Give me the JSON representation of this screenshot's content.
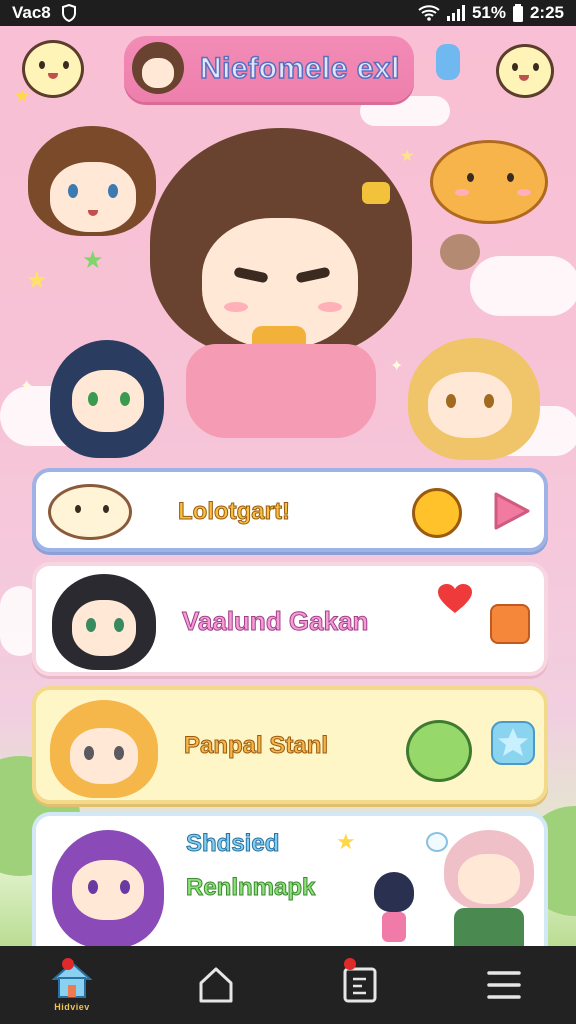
{
  "status_bar": {
    "left_text": "Vac8",
    "battery": "51%",
    "time": "2:25"
  },
  "header": {
    "title": "Niefomele exl"
  },
  "cards": [
    {
      "label": "Lolotgart!",
      "action_icon": "play-arrow-icon",
      "mascot_icon": "sun-mascot-icon"
    },
    {
      "label": "Vaalund Gakan",
      "action_icon": "shopping-bag-icon",
      "mascot_icon": "heart-icon"
    },
    {
      "label": "Panpal Stanl",
      "action_icon": "star-icon",
      "mascot_icon": "bunny-mascot-icon"
    },
    {
      "label_line1": "Shdsied",
      "label_line2": "Renlnmapk",
      "mascot_icon": "chat-bubble-icon"
    }
  ],
  "bottom_nav": {
    "items": [
      {
        "name": "home",
        "label": "Hidviev",
        "icon": "home-icon",
        "badge": true
      },
      {
        "name": "house",
        "label": "",
        "icon": "house-outline-icon",
        "badge": false
      },
      {
        "name": "notes",
        "label": "",
        "icon": "note-icon",
        "badge": true,
        "badge_count": "1"
      },
      {
        "name": "menu",
        "label": "",
        "icon": "menu-icon",
        "badge": false
      }
    ]
  },
  "colors": {
    "background": "#f7c6d8",
    "title_pill": "#ee7fac",
    "card1_border": "#9eb2e6",
    "card2_border": "#f2c6d8",
    "card3_bg": "#fff6c8",
    "card4_border": "#c5e0f2",
    "nav_bg": "#222222"
  }
}
